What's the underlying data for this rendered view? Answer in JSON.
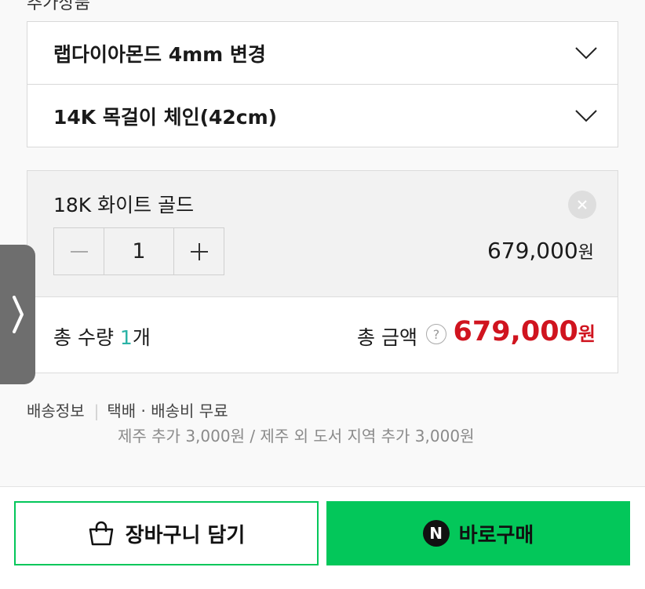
{
  "options": {
    "section_label_partial": "추가상품",
    "selects": [
      {
        "label": "랩다이아몬드 4mm 변경"
      },
      {
        "label": "14K 목걸이 체인(42cm)"
      }
    ]
  },
  "selected_item": {
    "name": "18K 화이트 골드",
    "quantity": "1",
    "price": "679,000",
    "price_unit": "원"
  },
  "totals": {
    "count_prefix": "총 수량 ",
    "count": "1",
    "count_suffix": "개",
    "amount_label": "총 금액",
    "help_glyph": "?",
    "amount": "679,000",
    "amount_unit": "원"
  },
  "shipping": {
    "label": "배송정보",
    "method": "택배 · 배송비 무료",
    "note": "제주 추가 3,000원 / 제주 외 도서 지역 추가 3,000원"
  },
  "actions": {
    "cart_label": "장바구니 담기",
    "buy_label": "바로구매",
    "npay_glyph": "N"
  },
  "colors": {
    "accent_green": "#03c75a",
    "total_red": "#d0141f",
    "count_teal": "#2ab3a6"
  },
  "icons": [
    "chevron-down-icon",
    "close-icon",
    "minus-icon",
    "plus-icon",
    "help-icon",
    "chevron-right-icon",
    "shopping-bag-icon",
    "naver-pay-icon"
  ]
}
